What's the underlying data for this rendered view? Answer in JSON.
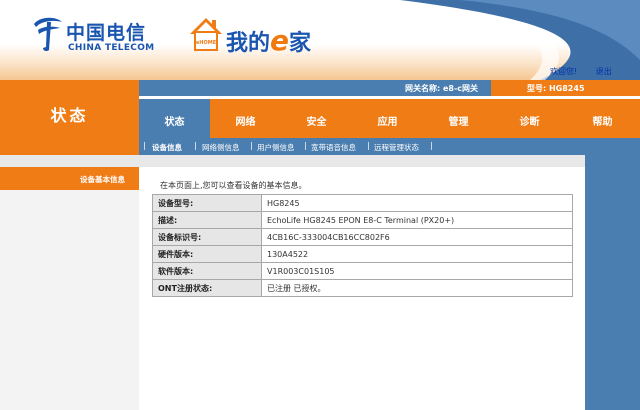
{
  "header": {
    "brand_cn": "中国电信",
    "brand_en": "CHINA TELECOM",
    "ehome_badge": "eHOME",
    "ehome_prefix": "我的",
    "ehome_e": "e",
    "ehome_suffix": "家",
    "welcome": "欢迎您!",
    "logout": "退出"
  },
  "status_bar": {
    "section_title": "状态",
    "gateway_name": "网关名称: e8-c网关",
    "model": "型号: HG8245"
  },
  "nav": {
    "tabs": [
      {
        "label": "状态",
        "active": true
      },
      {
        "label": "网络",
        "active": false
      },
      {
        "label": "安全",
        "active": false
      },
      {
        "label": "应用",
        "active": false
      },
      {
        "label": "管理",
        "active": false
      },
      {
        "label": "诊断",
        "active": false
      },
      {
        "label": "帮助",
        "active": false
      }
    ],
    "subtabs": [
      {
        "label": "设备信息",
        "active": true
      },
      {
        "label": "网络侧信息",
        "active": false
      },
      {
        "label": "用户侧信息",
        "active": false
      },
      {
        "label": "宽带语音信息",
        "active": false
      },
      {
        "label": "远程管理状态",
        "active": false
      }
    ]
  },
  "sidebar": {
    "items": [
      {
        "label": "设备基本信息",
        "active": true
      }
    ]
  },
  "main": {
    "intro": "在本页面上,您可以查看设备的基本信息。",
    "rows": [
      {
        "key": "设备型号:",
        "value": "HG8245"
      },
      {
        "key": "描述:",
        "value": "EchoLife HG8245 EPON E8-C Terminal (PX20+)"
      },
      {
        "key": "设备标识号:",
        "value": "4CB16C-333004CB16CC802F6"
      },
      {
        "key": "硬件版本:",
        "value": "130A4522"
      },
      {
        "key": "软件版本:",
        "value": "V1R003C01S105"
      },
      {
        "key": "ONT注册状态:",
        "value": "已注册 已授权。"
      }
    ]
  },
  "colors": {
    "orange": "#f07c16",
    "blue": "#4a7eb0",
    "brand_blue": "#1a56b0"
  }
}
